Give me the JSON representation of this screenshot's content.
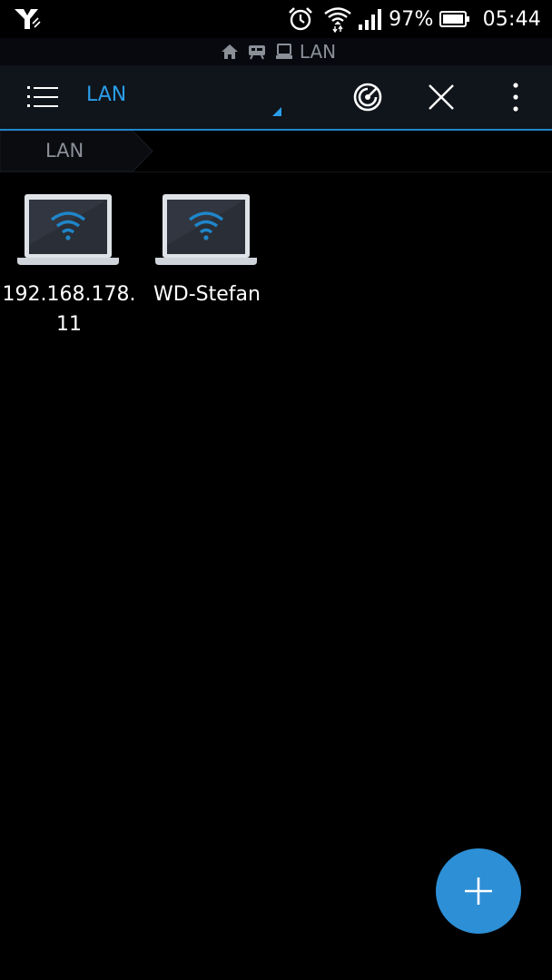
{
  "status_bar": {
    "battery_percent": "97%",
    "time": "05:44",
    "icons": [
      "carrier-logo-icon",
      "alarm-clock-icon",
      "wifi-icon",
      "cell-signal-icon",
      "battery-icon"
    ]
  },
  "path_strip": {
    "icons": [
      "home-icon",
      "storage-icon",
      "computer-icon"
    ],
    "label": "LAN"
  },
  "toolbar": {
    "title": "LAN",
    "icons": [
      "menu-icon",
      "radar-scan-icon",
      "close-icon",
      "more-vert-icon"
    ]
  },
  "breadcrumb": {
    "items": [
      {
        "label": "LAN"
      }
    ]
  },
  "devices": [
    {
      "name": "192.168.178.11",
      "icon": "laptop-wifi-icon"
    },
    {
      "name": "WD-Stefan",
      "icon": "laptop-wifi-icon"
    }
  ],
  "fab": {
    "icon": "plus-icon"
  },
  "colors": {
    "accent": "#2a9de8",
    "fab": "#2d8fd6",
    "toolbar_bg": "#10141b",
    "background": "#000000"
  }
}
